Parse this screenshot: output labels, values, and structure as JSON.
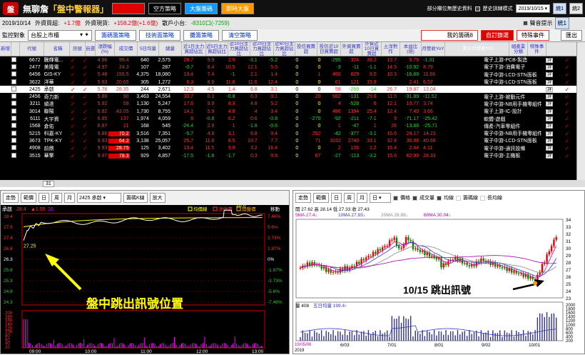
{
  "app": {
    "logo": "盤",
    "name": "無聊詹",
    "title": "「盤中警報器」"
  },
  "toolbar": {
    "buttons": [
      "多方策略",
      "空方策略",
      "大盤籌碼",
      "即時大盤"
    ],
    "notice": "部分欄位無歷史資料",
    "history": "歷史訓練模式",
    "date": "2019/10/15",
    "tabs": [
      "統1",
      "統2"
    ]
  },
  "status": {
    "date": "2019/10/14",
    "foreign_label": "外資買超:",
    "foreign_value": "+1.7億",
    "foreign2_label": "外資現貨:",
    "foreign2_value": "+158.2億(+1.6億)",
    "small_label": "散戶小台:",
    "small_value": "-8310口(-7259)",
    "alert": "聲音提示",
    "tabs": [
      "統1"
    ]
  },
  "controls": {
    "monitor_label": "監控對象",
    "monitor_value": "台股上市櫃",
    "btns": [
      "籌碼籌策略",
      "技術面策略",
      "攤籌策略",
      "清空策略"
    ],
    "right": [
      "我的籌碼8",
      "自訂篩選",
      "特殊事件"
    ],
    "export": "匯出"
  },
  "table": {
    "headers": [
      "新增",
      "",
      "代號",
      "名稱",
      "訊號",
      "自選",
      "漲跌幅(%)",
      "成交價",
      "5日均量",
      "總量",
      "近1日主力買超佔比",
      "近5日主力買超佔比",
      "近10日主力買超佔比",
      "近20日主力買超佔比",
      "近60日主力買超佔比",
      "投信買賣超",
      "投信近10日買賣超",
      "外資買賣超",
      "外資近10日買賣超",
      "土洋對作",
      "本益比(倍)",
      "月營收YoY",
      "累計月營收YoY",
      "細產業分類",
      "特殊事件",
      "買權"
    ],
    "rows": [
      [
        "6672",
        "騰輝電...",
        "4.96",
        "99.4",
        "640",
        "2,575",
        "28.7",
        "9.9",
        "2.9",
        "-3.1",
        "-5.2",
        "0",
        "0",
        "-295",
        "324",
        "39.2",
        "13.7",
        "5.76",
        "-1.31",
        "電子上游-PCB-製造"
      ],
      [
        "2477",
        "美隆電",
        "4.97",
        "24.3",
        "107",
        "287",
        "-0.7",
        "8.4",
        "10.5",
        "12.1",
        "5.5",
        "0",
        "0",
        "-3",
        "-11",
        "-1.1",
        "14.5",
        "-10.92",
        "8.79",
        "電子下游-消費電子"
      ],
      [
        "6456",
        "GIS-KY",
        "5.48",
        "155.5",
        "4,375",
        "18,080",
        "10.4",
        "7.4",
        "-1",
        "2.1",
        "1.4",
        "0",
        "1",
        "460",
        "829",
        "9.5",
        "10.3",
        "-16.89",
        "11.66",
        "電子中游-LCD-STN面板"
      ],
      [
        "3622",
        "洋華",
        "5.63",
        "20.65",
        "305",
        "1,272",
        "6.3",
        "8.9",
        "11.6",
        "11.6",
        "12.4",
        "0",
        "0",
        "61",
        "121",
        "15.9",
        "",
        "2.41",
        "6.57",
        "電子中游-LCD-STN面板"
      ],
      [
        "2425",
        "承啟",
        "5.78",
        "28.35",
        "244",
        "2,671",
        "12.3",
        "4.5",
        "1.4",
        "6.8",
        "3.1",
        "0",
        "0",
        "58",
        "-269",
        "-14",
        "26.7",
        "19.87",
        "13.04",
        "電子中游-主機板"
      ],
      [
        "2456",
        "奇力新",
        "5.88",
        "90",
        "3,463",
        "24,554",
        "30.7",
        "0.1",
        "-0.8",
        "6.3",
        "0.1",
        "0",
        "20",
        "982",
        "-131",
        "29.6",
        "11.5",
        "-31.89",
        "-11.52",
        "電子上游-被動元件"
      ],
      [
        "3211",
        "順達",
        "5.92",
        "59",
        "1,130",
        "5,247",
        "17.6",
        "9.9",
        "8.3",
        "4.8",
        "5.2",
        "0",
        "0",
        "4",
        "-528",
        "6",
        "12.1",
        "10.77",
        "3.74",
        "電子中游-NB用手機零組件"
      ],
      [
        "3014",
        "聯陽",
        "6.82",
        "43.05",
        "1,730",
        "8,755",
        "14.1",
        "5.9",
        "4.8",
        "4",
        "3.4",
        "0",
        "0",
        "486",
        "1394",
        "25.4",
        "12.4",
        "7.40",
        "3.66",
        "電子上游-IC-設計"
      ],
      [
        "6111",
        "大宇資",
        "6.85",
        "137",
        "1,974",
        "4,059",
        "6",
        "-0.8",
        "0.2",
        "0.6",
        "-0.8",
        "0",
        "-270",
        "-92",
        "-211",
        "-7.1",
        "9",
        "-71.17",
        "-25.42",
        "軟體-遊戲"
      ],
      [
        "1568",
        "倉佑",
        "6.87",
        "21",
        "168",
        "545",
        "-24.4",
        "2.9",
        "1",
        "-1.8",
        "-0.6",
        "0",
        "0",
        "1",
        "-47",
        "1",
        "26",
        "-13.66",
        "-25.71",
        "傳產-汽車零組件"
      ],
      [
        "5215",
        "科嘉-KY",
        "9.86",
        "70.2",
        "3,516",
        "7,351",
        "-5.7",
        "4.8",
        "3.1",
        "6.8",
        "0.4",
        "0",
        "252",
        "-42",
        "-377",
        "-3.1",
        "15.6",
        "24.17",
        "14.23",
        "電子中游-NB用手機零組件"
      ],
      [
        "3673",
        "TPK-KY",
        "9.93",
        "64.2",
        "3,138",
        "25,057",
        "25.7",
        "11.8",
        "8.5",
        "10.7",
        "7.7",
        "0",
        "71",
        "1032",
        "2740",
        "33.1",
        "32.8",
        "30.98",
        "40.68",
        "電子中游-LCD-STN面板"
      ],
      [
        "4908",
        "前鼎",
        "9.93",
        "28.75",
        "125",
        "3,402",
        "10.4",
        "11.5",
        "9.9",
        "3.2",
        "16.4",
        "0",
        "0",
        "2",
        "106",
        "1.2",
        "16.4",
        "2.44",
        "4.11",
        "電子中游-通訊設備"
      ],
      [
        "3515",
        "華擎",
        "9.97",
        "78.3",
        "929",
        "4,857",
        "-17.5",
        "-1.8",
        "-1.7",
        "0.3",
        "0.6",
        "0",
        "67",
        "-27",
        "-113",
        "-3.2",
        "15.6",
        "62.99",
        "28.33",
        "電子中游-主機板"
      ]
    ],
    "page": "31"
  },
  "intraday": {
    "tools": [
      "走勢",
      "範價",
      "日",
      "周",
      "月"
    ],
    "stock": "2425 承啟",
    "tools2": [
      "籌碼K線",
      "放大"
    ],
    "legend": [
      "均價線",
      "漲停價",
      "開盤價"
    ],
    "legend_btn": "移動",
    "info": {
      "name": "承啟",
      "price": "28.4",
      "chg": "▲1.55",
      "vol": "16"
    },
    "ylabels": [
      "28.4",
      "27.9",
      "27.4",
      "26.8",
      "26.3",
      "25.8",
      "25.3",
      "24.8",
      "24.3"
    ],
    "pct": [
      "7.46%",
      "5.6%",
      "3.73%",
      "1.87%",
      "0%",
      "-1.87%",
      "-3.73%",
      "-5.6%",
      "-7.46%"
    ],
    "vol_labels": [
      "200",
      "180",
      "160",
      "140",
      "120",
      "100",
      "80",
      "60",
      "40",
      "20"
    ],
    "xlabels": [
      "09:00",
      "10:00",
      "11:00",
      "12:00",
      "13:00"
    ],
    "annot_low": "27.25",
    "annot_high": "28.8",
    "signal": "盤中跳出訊號位置"
  },
  "daily": {
    "tools": [
      "走勢",
      "範價",
      "日",
      "周",
      "月"
    ],
    "period": "日",
    "checks": [
      "價格",
      "成交量",
      "均線",
      "籌碼線",
      "長均線"
    ],
    "info": "開 27.62  高 28.14  低 27.33  收 27.43",
    "ma": [
      "5MA 27.4↓",
      "10MA 27.93↓",
      "20MA 28.89↓",
      "60MA 30.04↓"
    ],
    "ylabels": [
      "34",
      "33",
      "32",
      "31",
      "30",
      "29",
      "28",
      "27",
      "26",
      "25",
      "24",
      "23"
    ],
    "vol_info": "量 408",
    "vol_ma": "五日均量 199.4↑",
    "vol_labels": [
      "2000",
      "1800",
      "1600",
      "1400",
      "1200",
      "1000",
      "800",
      "600",
      "400",
      "200"
    ],
    "xlabels": [
      "6/03",
      "7/01",
      "8/01",
      "9/02",
      "10/01"
    ],
    "start": "19/05/06",
    "year": "2019",
    "signal": "10/15  跳出訊號"
  },
  "colors": {
    "up": "#ff3333",
    "down": "#33cc33",
    "accent": "#f0c000"
  }
}
